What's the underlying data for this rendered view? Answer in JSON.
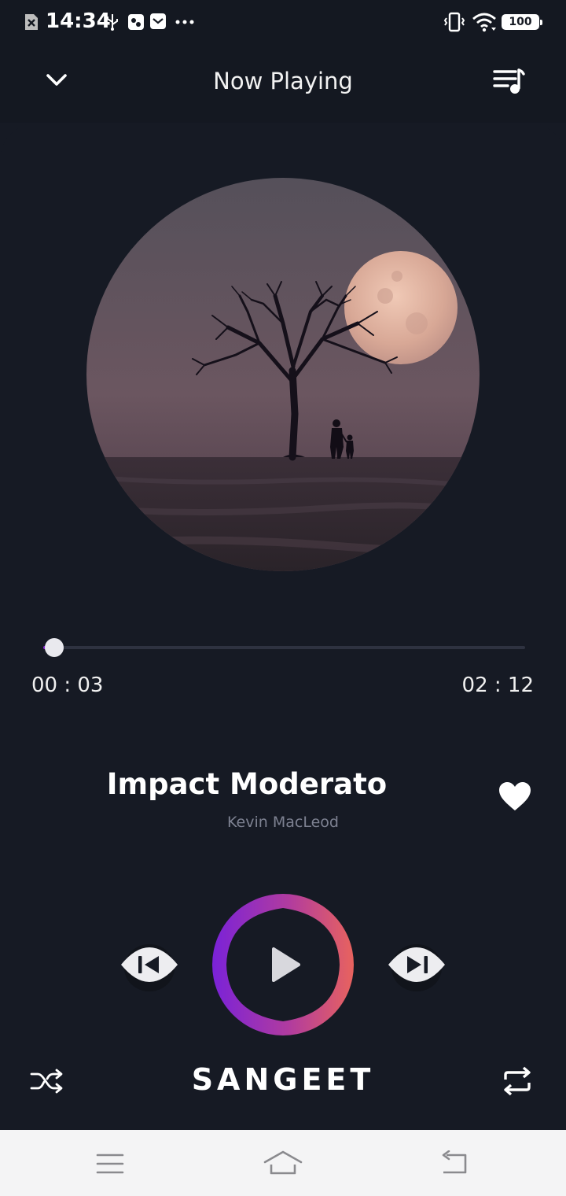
{
  "status_bar": {
    "time": "14:34",
    "battery": "100",
    "icons": [
      "sim-off-icon",
      "usb-icon",
      "app-notification-icon",
      "mail-icon",
      "more-dots-icon",
      "vibrate-icon",
      "wifi-icon",
      "battery-icon"
    ]
  },
  "header": {
    "title": "Now Playing",
    "left_icon": "chevron-down-icon",
    "right_icon": "playlist-icon"
  },
  "player": {
    "progress": 0.023,
    "elapsed": "00 : 03",
    "duration": "02 : 12",
    "song_title": "Impact Moderato",
    "artist": "Kevin MacLeod",
    "favorite": true,
    "state": "paused"
  },
  "footer": {
    "brand": "SANGEET",
    "left_icon": "shuffle-icon",
    "right_icon": "repeat-icon"
  },
  "navbar": {
    "icons": [
      "menu-icon",
      "home-icon",
      "back-icon"
    ]
  },
  "colors": {
    "background": "#161a24",
    "accent_start": "#7a22d8",
    "accent_end": "#e8635e",
    "muted_text": "#7d8191"
  }
}
